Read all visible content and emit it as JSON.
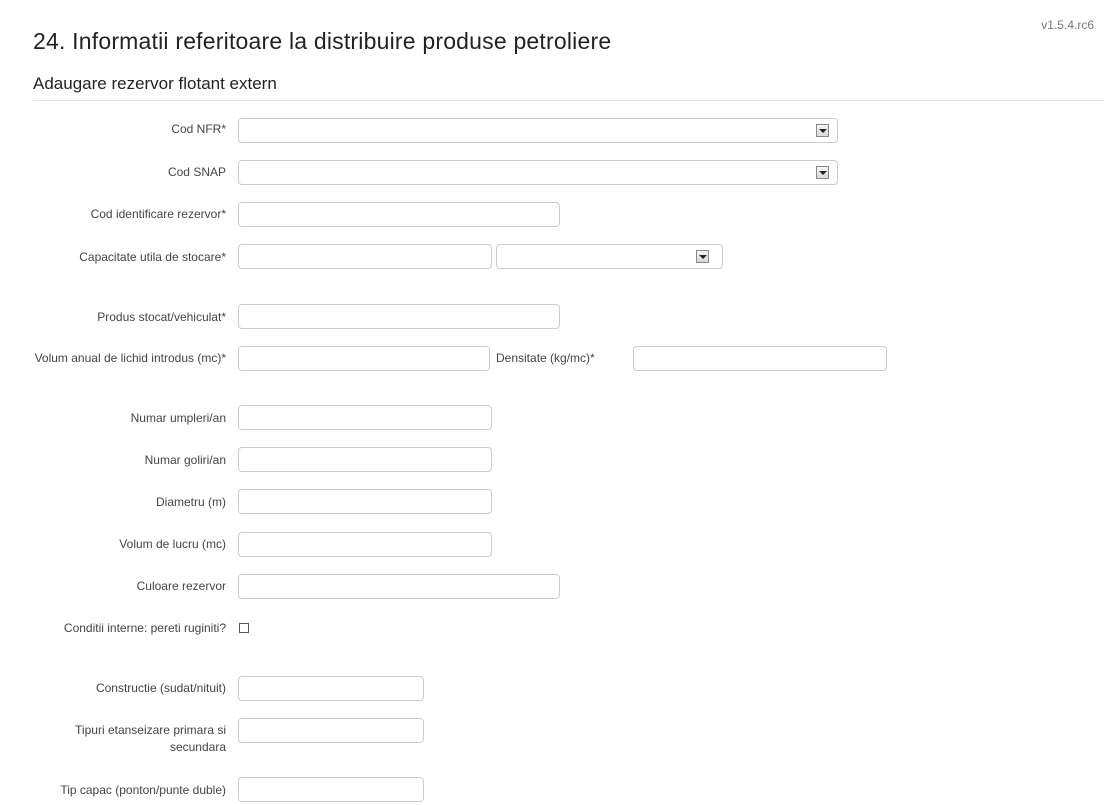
{
  "version": "v1.5.4.rc6",
  "page_title": "24. Informatii referitoare la distribuire produse petroliere",
  "section_title": "Adaugare rezervor flotant extern",
  "fields": {
    "cod_nfr": {
      "label": "Cod NFR*",
      "value": ""
    },
    "cod_snap": {
      "label": "Cod SNAP",
      "value": ""
    },
    "cod_identificare": {
      "label": "Cod identificare rezervor*",
      "value": ""
    },
    "capacitate": {
      "label": "Capacitate utila de stocare*",
      "value": "",
      "unit_value": ""
    },
    "produs": {
      "label": "Produs stocat/vehiculat*",
      "value": ""
    },
    "volum_anual": {
      "label": "Volum anual de lichid introdus (mc)*",
      "value": ""
    },
    "densitate": {
      "label": "Densitate (kg/mc)*",
      "value": ""
    },
    "umpleri": {
      "label": "Numar umpleri/an",
      "value": ""
    },
    "goliri": {
      "label": "Numar goliri/an",
      "value": ""
    },
    "diametru": {
      "label": "Diametru (m)",
      "value": ""
    },
    "volum_lucru": {
      "label": "Volum de lucru (mc)",
      "value": ""
    },
    "culoare": {
      "label": "Culoare rezervor",
      "value": ""
    },
    "conditii": {
      "label": "Conditii interne: pereti ruginiti?",
      "checked": false
    },
    "constructie": {
      "label": "Constructie (sudat/nituit)",
      "value": ""
    },
    "tipuri_etanseizare": {
      "label": "Tipuri etanseizare primara si secundara",
      "value": ""
    },
    "tip_capac": {
      "label": "Tip capac (ponton/punte duble)",
      "value": ""
    }
  },
  "icons": {
    "select_arrow": "chevron-down-icon",
    "checkbox": "checkbox-icon"
  }
}
